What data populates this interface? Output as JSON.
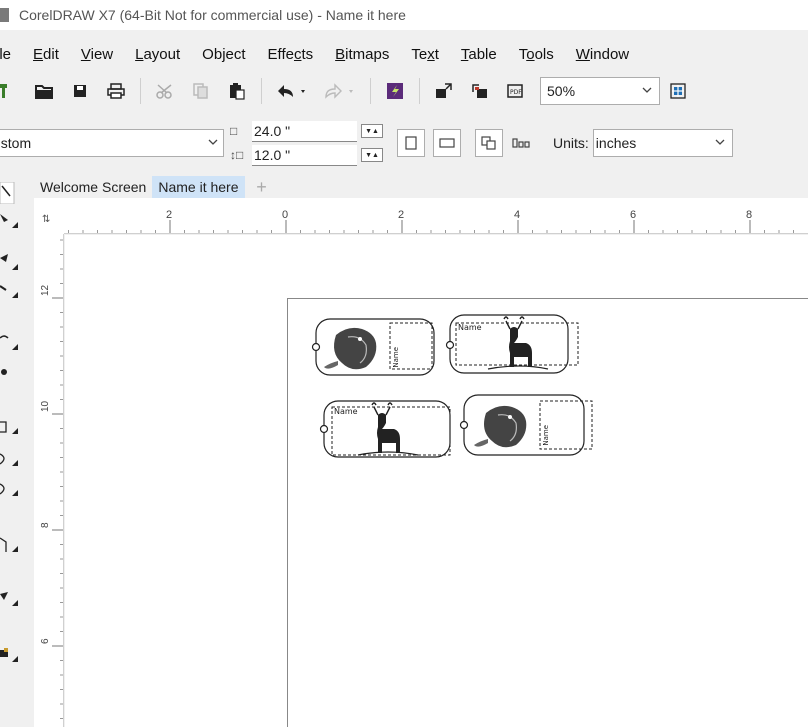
{
  "window": {
    "title": "CorelDRAW X7 (64-Bit Not for commercial use) - Name it here"
  },
  "menu": [
    {
      "label": "ile",
      "accel": ""
    },
    {
      "label": "Edit",
      "accel": "E"
    },
    {
      "label": "View",
      "accel": "V"
    },
    {
      "label": "Layout",
      "accel": "L"
    },
    {
      "label": "Object",
      "accel": "j"
    },
    {
      "label": "Effects",
      "accel": "c"
    },
    {
      "label": "Bitmaps",
      "accel": "B"
    },
    {
      "label": "Text",
      "accel": "x"
    },
    {
      "label": "Table",
      "accel": "T"
    },
    {
      "label": "Tools",
      "accel": "o"
    },
    {
      "label": "Window",
      "accel": "W"
    }
  ],
  "toolbar": {
    "zoom_value": "50%",
    "icons": [
      "new-icon",
      "open-icon",
      "save-icon",
      "print-icon",
      "cut-icon",
      "copy-icon",
      "paste-icon",
      "undo-icon",
      "redo-icon",
      "search-content-icon",
      "import-icon",
      "export-icon",
      "publish-pdf-icon",
      "full-screen-icon"
    ]
  },
  "property_bar": {
    "paper_type": "ustom",
    "width": "24.0 \"",
    "height": "12.0 \"",
    "units_label": "Units:",
    "units_value": "inches"
  },
  "tabs": [
    {
      "label": "Welcome Screen",
      "active": false
    },
    {
      "label": "Name it here",
      "active": true
    }
  ],
  "ruler": {
    "horizontal_labels": [
      "2",
      "0",
      "2",
      "4",
      "6",
      "8"
    ],
    "vertical_labels": [
      "12",
      "10",
      "8",
      "6"
    ]
  },
  "tags": [
    {
      "name_text": "Name",
      "image": "fish"
    },
    {
      "name_text": "Name",
      "image": "deer"
    },
    {
      "name_text": "Name",
      "image": "deer"
    },
    {
      "name_text": "Name",
      "image": "fish"
    }
  ],
  "colors": {
    "active_tab": "#cfe3f7",
    "chrome": "#f0f0f0",
    "canvas": "#ffffff"
  }
}
